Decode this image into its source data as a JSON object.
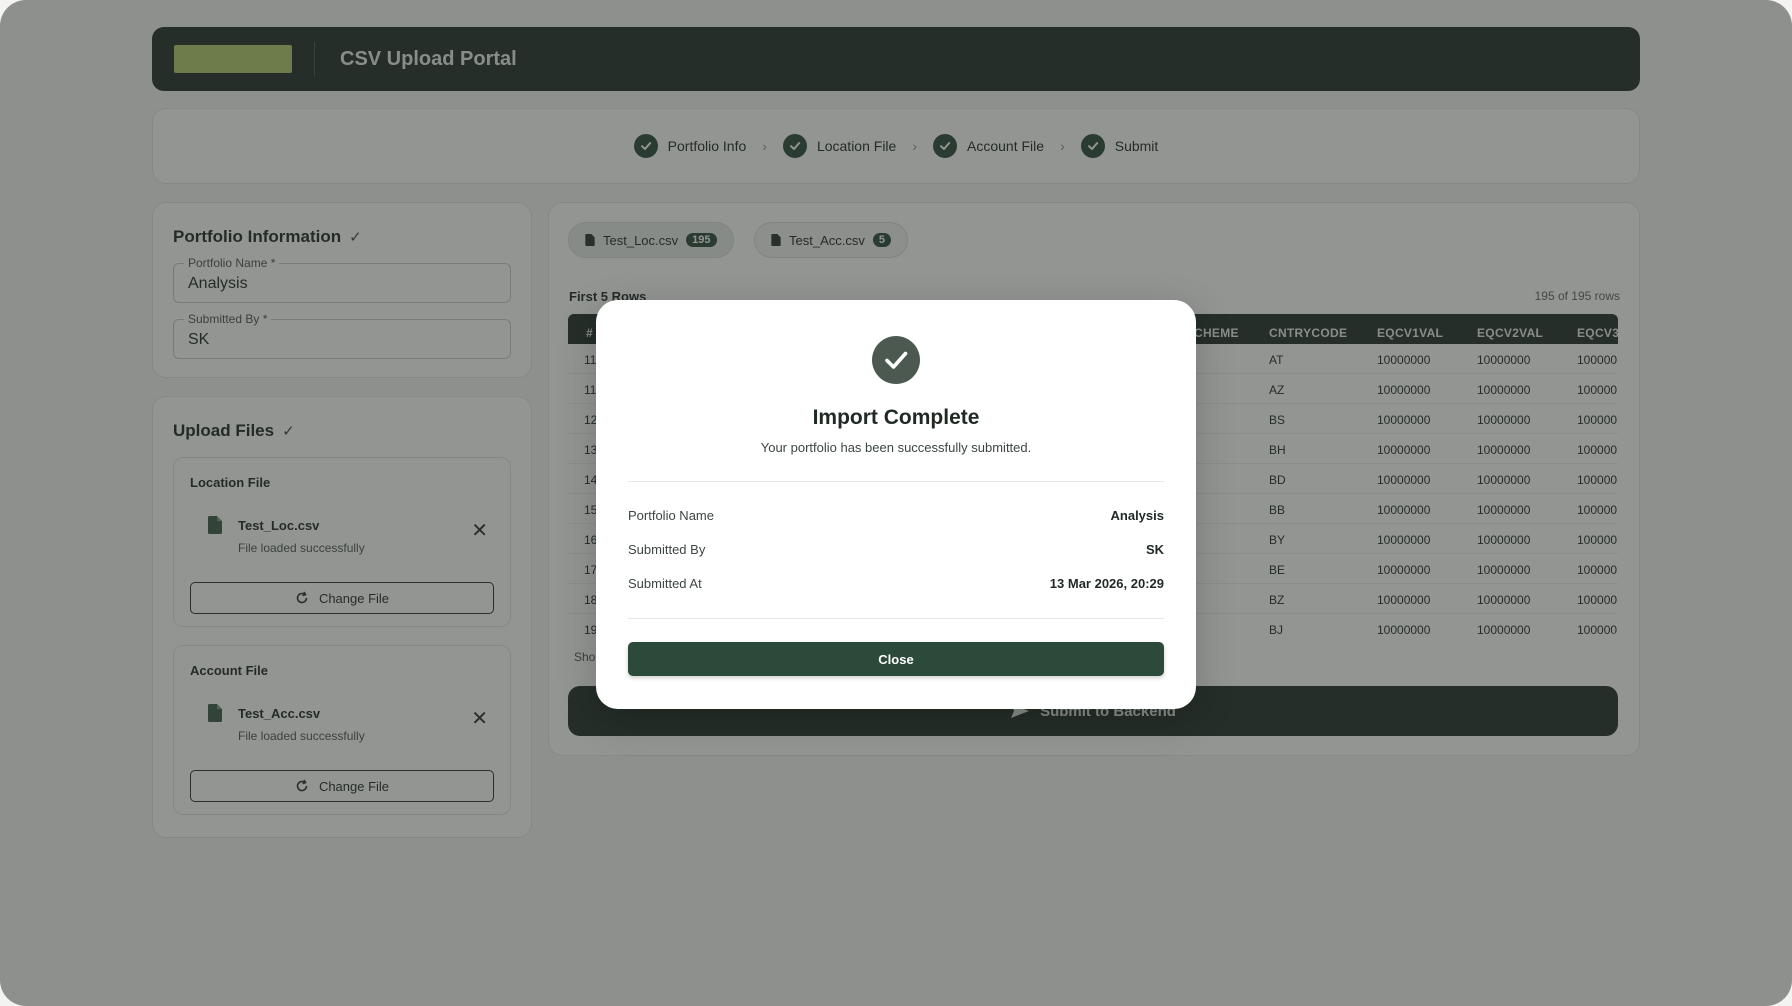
{
  "header": {
    "title": "CSV Upload Portal"
  },
  "stepper": {
    "steps": [
      {
        "label": "Portfolio Info"
      },
      {
        "label": "Location File"
      },
      {
        "label": "Account File"
      },
      {
        "label": "Submit"
      }
    ]
  },
  "portfolio": {
    "title": "Portfolio Information",
    "name_label": "Portfolio Name *",
    "name_value": "Analysis",
    "submitted_by_label": "Submitted By *",
    "submitted_by_value": "SK"
  },
  "upload": {
    "title": "Upload Files",
    "location": {
      "title": "Location File",
      "file_name": "Test_Loc.csv",
      "status": "File loaded successfully",
      "change_label": "Change File"
    },
    "account": {
      "title": "Account File",
      "file_name": "Test_Acc.csv",
      "status": "File loaded successfully",
      "change_label": "Change File"
    }
  },
  "preview": {
    "tabs": [
      {
        "label": "Test_Loc.csv",
        "count": "195"
      },
      {
        "label": "Test_Acc.csv",
        "count": "5"
      }
    ],
    "rows_label": "First 5 Rows",
    "rows_count": "195 of 195 rows",
    "columns": [
      "#",
      "CHEME",
      "CNTRYCODE",
      "EQCV1VAL",
      "EQCV2VAL",
      "EQCV3"
    ],
    "rows": [
      {
        "idx": "11",
        "code": "AT",
        "v1": "10000000",
        "v2": "10000000",
        "v3": "100000"
      },
      {
        "idx": "11",
        "code": "AZ",
        "v1": "10000000",
        "v2": "10000000",
        "v3": "100000"
      },
      {
        "idx": "12",
        "code": "BS",
        "v1": "10000000",
        "v2": "10000000",
        "v3": "100000"
      },
      {
        "idx": "13",
        "code": "BH",
        "v1": "10000000",
        "v2": "10000000",
        "v3": "100000"
      },
      {
        "idx": "14",
        "code": "BD",
        "v1": "10000000",
        "v2": "10000000",
        "v3": "100000"
      },
      {
        "idx": "15",
        "code": "BB",
        "v1": "10000000",
        "v2": "10000000",
        "v3": "100000"
      },
      {
        "idx": "16",
        "code": "BY",
        "v1": "10000000",
        "v2": "10000000",
        "v3": "100000"
      },
      {
        "idx": "17",
        "code": "BE",
        "v1": "10000000",
        "v2": "10000000",
        "v3": "100000"
      },
      {
        "idx": "18",
        "code": "BZ",
        "v1": "10000000",
        "v2": "10000000",
        "v3": "100000"
      },
      {
        "idx": "19",
        "code": "BJ",
        "v1": "10000000",
        "v2": "10000000",
        "v3": "100000"
      }
    ],
    "showing": "Sho",
    "submit_label": "Submit to Backend"
  },
  "modal": {
    "title": "Import Complete",
    "subtitle": "Your portfolio has been successfully submitted.",
    "details": [
      {
        "label": "Portfolio Name",
        "value": "Analysis"
      },
      {
        "label": "Submitted By",
        "value": "SK"
      },
      {
        "label": "Submitted At",
        "value": "13 Mar 2026, 20:29"
      }
    ],
    "close_label": "Close"
  },
  "colors": {
    "primary": "#2c4a3a",
    "header_bg": "#233129",
    "logo_accent": "#b5cc6c"
  }
}
